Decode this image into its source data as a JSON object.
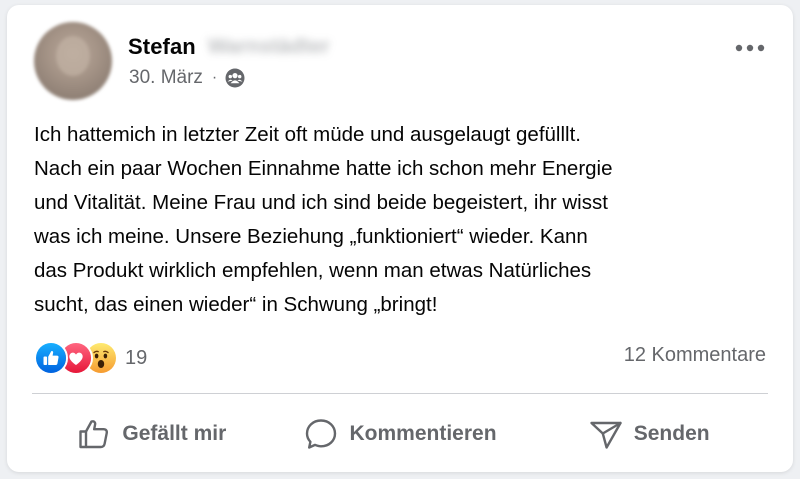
{
  "post": {
    "author_first_name": "Stefan",
    "author_last_name_blurred": "Warnstädter",
    "date": "30. März",
    "separator": "·",
    "audience_icon": "friends-icon",
    "text_lines": [
      "Ich hattemich in letzter Zeit oft müde und ausgelaugt gefülllt.",
      "Nach ein paar Wochen Einnahme hatte ich schon mehr Energie",
      "und Vitalität. Meine Frau und ich sind beide begeistert, ihr wisst",
      "was ich meine. Unsere Beziehung „funktioniert“ wieder. Kann",
      "das Produkt wirklich empfehlen, wenn man etwas Natürliches",
      "sucht, das einen wieder“ in Schwung „bringt!"
    ]
  },
  "stats": {
    "reactions": [
      "like-icon",
      "love-icon",
      "wow-icon"
    ],
    "reaction_count": "19",
    "comments_label": "12 Kommentare"
  },
  "actions": {
    "like_label": "Gefällt mir",
    "comment_label": "Kommentieren",
    "share_label": "Senden"
  },
  "colors": {
    "like_blue": "#1877f2",
    "love_red": "#f33e58",
    "wow_yellow": "#f7b125",
    "secondary_text": "#65676b"
  }
}
